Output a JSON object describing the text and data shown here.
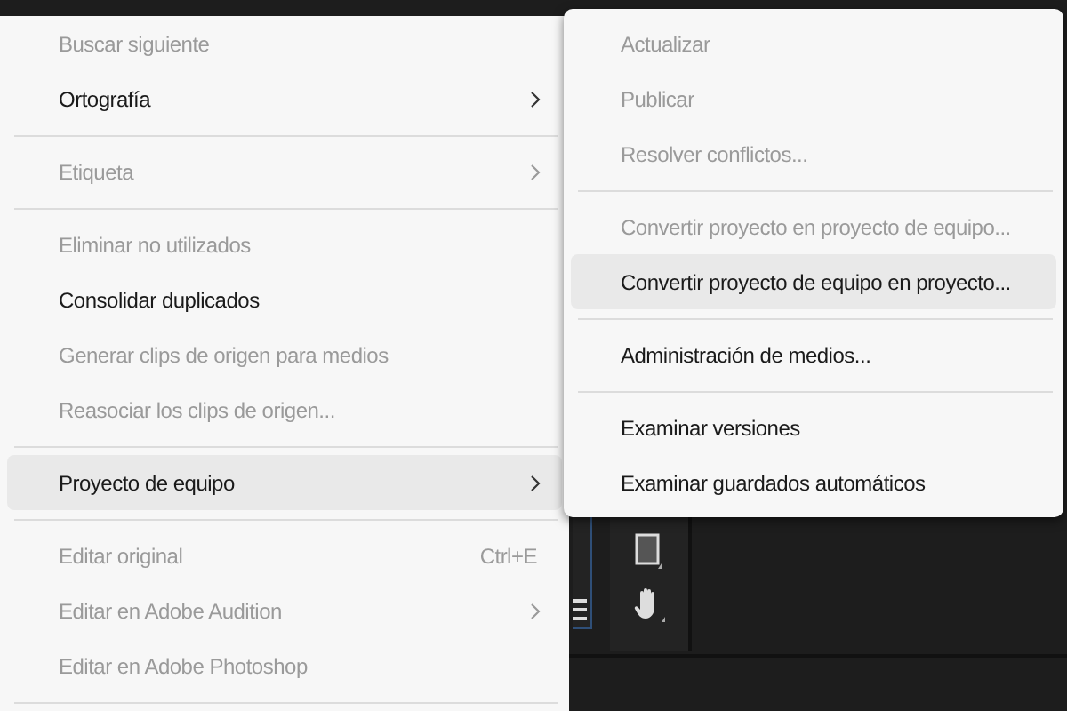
{
  "context_menu": {
    "items": [
      {
        "kind": "item",
        "label": "Buscar siguiente",
        "disabled": true,
        "submenu": false,
        "highlighted": false
      },
      {
        "kind": "item",
        "label": "Ortografía",
        "disabled": false,
        "submenu": true,
        "highlighted": false
      },
      {
        "kind": "separator"
      },
      {
        "kind": "item",
        "label": "Etiqueta",
        "disabled": true,
        "submenu": true,
        "highlighted": false
      },
      {
        "kind": "separator"
      },
      {
        "kind": "item",
        "label": "Eliminar no utilizados",
        "disabled": true,
        "submenu": false,
        "highlighted": false
      },
      {
        "kind": "item",
        "label": "Consolidar duplicados",
        "disabled": false,
        "submenu": false,
        "highlighted": false
      },
      {
        "kind": "item",
        "label": "Generar clips de origen para medios",
        "disabled": true,
        "submenu": false,
        "highlighted": false
      },
      {
        "kind": "item",
        "label": "Reasociar los clips de origen...",
        "disabled": true,
        "submenu": false,
        "highlighted": false
      },
      {
        "kind": "separator"
      },
      {
        "kind": "item",
        "label": "Proyecto de equipo",
        "disabled": false,
        "submenu": true,
        "highlighted": true
      },
      {
        "kind": "separator"
      },
      {
        "kind": "item",
        "label": "Editar original",
        "shortcut": "Ctrl+E",
        "disabled": true,
        "submenu": false,
        "highlighted": false
      },
      {
        "kind": "item",
        "label": "Editar en Adobe Audition",
        "disabled": true,
        "submenu": true,
        "highlighted": false
      },
      {
        "kind": "item",
        "label": "Editar en Adobe Photoshop",
        "disabled": true,
        "submenu": false,
        "highlighted": false
      },
      {
        "kind": "separator"
      }
    ]
  },
  "submenu": {
    "items": [
      {
        "kind": "item",
        "label": "Actualizar",
        "disabled": true,
        "highlighted": false
      },
      {
        "kind": "item",
        "label": "Publicar",
        "disabled": true,
        "highlighted": false
      },
      {
        "kind": "item",
        "label": "Resolver conflictos...",
        "disabled": true,
        "highlighted": false
      },
      {
        "kind": "separator"
      },
      {
        "kind": "item",
        "label": "Convertir proyecto en proyecto de equipo...",
        "disabled": true,
        "highlighted": false
      },
      {
        "kind": "item",
        "label": "Convertir proyecto de equipo en proyecto...",
        "disabled": false,
        "highlighted": true
      },
      {
        "kind": "separator"
      },
      {
        "kind": "item",
        "label": "Administración de medios...",
        "disabled": false,
        "highlighted": false
      },
      {
        "kind": "separator"
      },
      {
        "kind": "item",
        "label": "Examinar versiones",
        "disabled": false,
        "highlighted": false
      },
      {
        "kind": "item",
        "label": "Examinar guardados automáticos",
        "disabled": false,
        "highlighted": false
      }
    ]
  }
}
